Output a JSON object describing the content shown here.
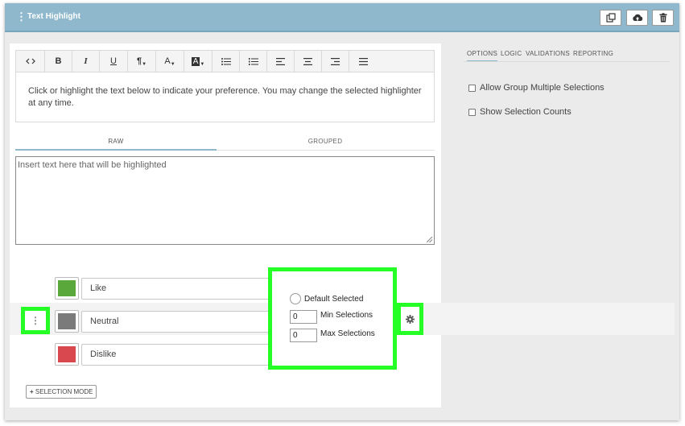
{
  "header": {
    "title": "Text Highlight",
    "drag_glyph": "⋮"
  },
  "header_buttons": [
    {
      "name": "copy-button",
      "icon": "copy-icon"
    },
    {
      "name": "save-button",
      "icon": "cloud-upload-icon"
    },
    {
      "name": "delete-button",
      "icon": "trash-icon"
    }
  ],
  "toolbar": [
    {
      "name": "code-view-button",
      "glyph": "<>"
    },
    {
      "name": "bold-button",
      "glyph": "B"
    },
    {
      "name": "italic-button",
      "glyph": "I"
    },
    {
      "name": "underline-button",
      "glyph": "U"
    },
    {
      "name": "paragraph-button",
      "glyph": "¶"
    },
    {
      "name": "font-color-button",
      "glyph": "A"
    },
    {
      "name": "highlight-color-button",
      "glyph": "A"
    },
    {
      "name": "bullet-list-button",
      "glyph": "bullets"
    },
    {
      "name": "numbered-list-button",
      "glyph": "numbers"
    },
    {
      "name": "align-left-button",
      "glyph": "left"
    },
    {
      "name": "align-center-button",
      "glyph": "center"
    },
    {
      "name": "align-right-button",
      "glyph": "right"
    },
    {
      "name": "justify-button",
      "glyph": "justify"
    }
  ],
  "prompt_text": "Click or highlight the text below to indicate your preference. You may change the selected highlighter at any time.",
  "content_tabs": {
    "raw": "RAW",
    "grouped": "GROUPED",
    "active": "raw"
  },
  "textarea_placeholder": "Insert text here that will be highlighted",
  "highlighters": [
    {
      "label": "Like",
      "color": "#5aa83c"
    },
    {
      "label": "Neutral",
      "color": "#7a7a7a"
    },
    {
      "label": "Dislike",
      "color": "#d9474f"
    }
  ],
  "popup": {
    "default_selected_label": "Default Selected",
    "min_label": "Min Selections",
    "min_value": "0",
    "max_label": "Max Selections",
    "max_value": "0"
  },
  "selection_mode_label": "SELECTION MODE",
  "side_tabs": [
    "OPTIONS",
    "LOGIC",
    "VALIDATIONS",
    "REPORTING"
  ],
  "side_options": {
    "allow_group": "Allow Group Multiple Selections",
    "show_counts": "Show Selection Counts"
  },
  "colors": {
    "header": "#8fb8cc",
    "highlight_outline": "#25ff25"
  }
}
